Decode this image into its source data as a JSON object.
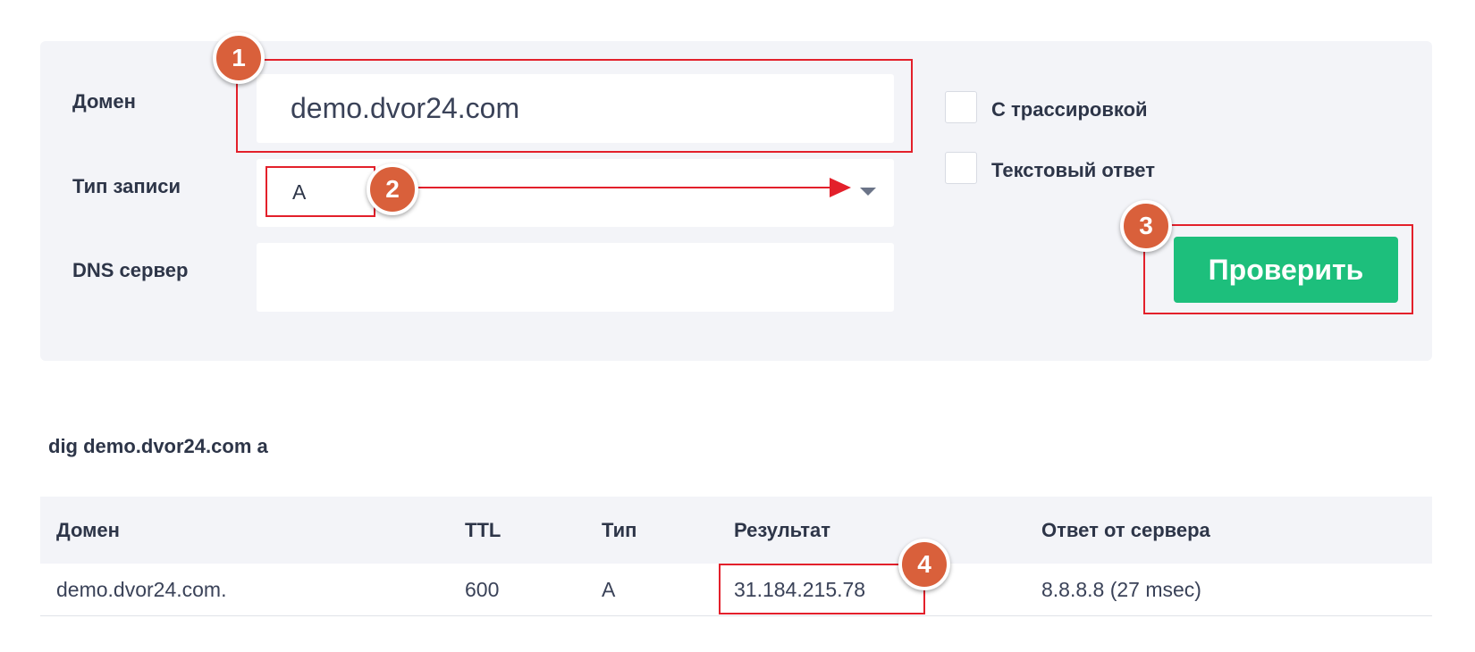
{
  "form": {
    "domain_label": "Домен",
    "domain_value": "demo.dvor24.com",
    "record_type_label": "Тип записи",
    "record_type_value": "A",
    "dns_server_label": "DNS сервер",
    "dns_server_value": "",
    "trace_checkbox_label": "С трассировкой",
    "trace_checked": false,
    "text_response_checkbox_label": "Текстовый ответ",
    "text_response_checked": false,
    "submit_label": "Проверить"
  },
  "result": {
    "command": "dig demo.dvor24.com a",
    "columns": [
      "Домен",
      "TTL",
      "Тип",
      "Результат",
      "Ответ от сервера"
    ],
    "rows": [
      [
        "demo.dvor24.com.",
        "600",
        "A",
        "31.184.215.78",
        "8.8.8.8 (27 msec)"
      ]
    ]
  },
  "annotations": {
    "markers": [
      "1",
      "2",
      "3",
      "4"
    ]
  },
  "colors": {
    "panel_bg": "#f3f4f8",
    "button_bg": "#1dbf7c",
    "annotation_red": "#e3202b",
    "marker_orange": "#d9603b"
  }
}
